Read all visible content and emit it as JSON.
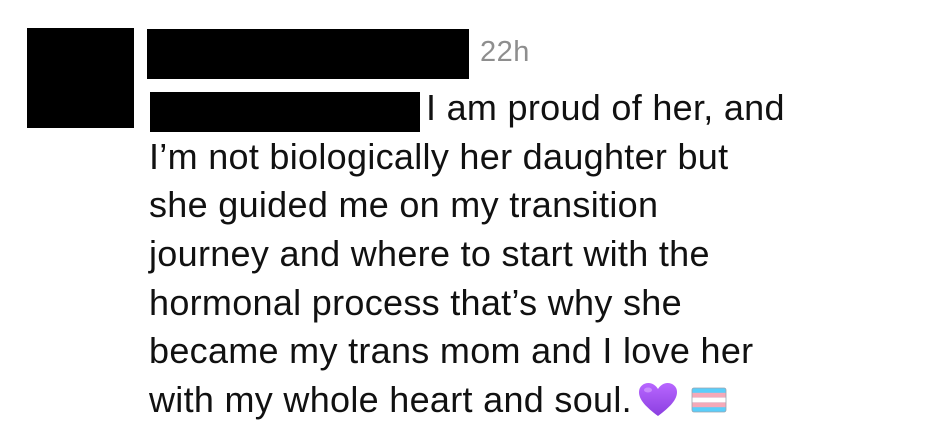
{
  "comment": {
    "timestamp": "22h",
    "text_lines": [
      "I am proud of her, and",
      "I’m not biologically her daughter but",
      "she guided me on my transition",
      "journey and where to start with the",
      "hormonal process that’s why she",
      "became my trans mom and I love her",
      "with my whole heart and soul."
    ],
    "emojis": [
      "purple-heart-icon",
      "transgender-flag-icon"
    ],
    "colors": {
      "text": "#111111",
      "timestamp": "#8e8e8e",
      "redaction": "#000000",
      "heart": "#a855f7",
      "flag_blue": "#5bcefa",
      "flag_pink": "#f5a9b8",
      "flag_white": "#ffffff"
    }
  }
}
